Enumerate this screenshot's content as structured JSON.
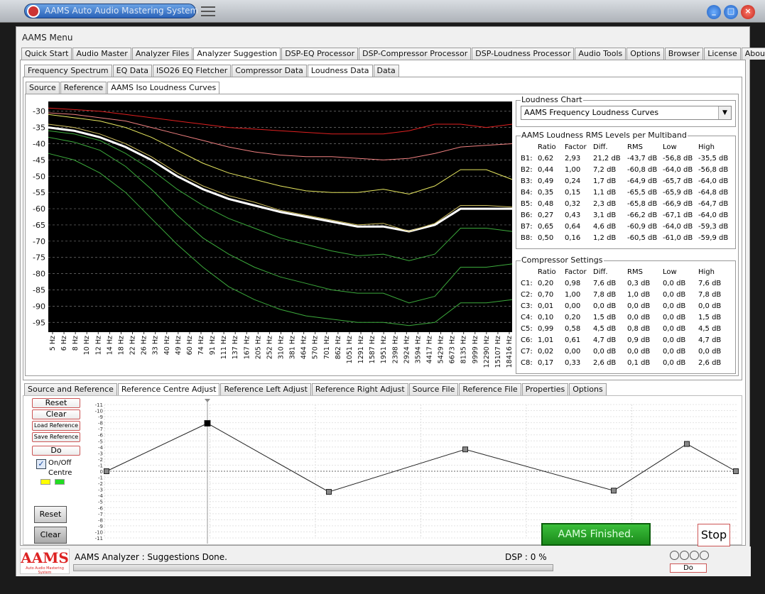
{
  "window": {
    "title": "AAMS Auto Audio Mastering System",
    "min": "_",
    "max": "□",
    "close": "×"
  },
  "menu_title": "AAMS Menu",
  "main_tabs": [
    "Quick Start",
    "Audio Master",
    "Analyzer Files",
    "Analyzer Suggestion",
    "DSP-EQ Processor",
    "DSP-Compressor Processor",
    "DSP-Loudness Processor",
    "Audio Tools",
    "Options",
    "Browser",
    "License",
    "About"
  ],
  "sub_tabs": [
    "Frequency Spectrum",
    "EQ Data",
    "ISO26 EQ Fletcher",
    "Compressor Data",
    "Loudness Data",
    "Data"
  ],
  "sub_sub_tabs": [
    "Source",
    "Reference",
    "AAMS Iso Loudness Curves"
  ],
  "chart_data": {
    "type": "line",
    "y_ticks": [
      "-30",
      "-35",
      "-40",
      "-45",
      "-50",
      "-55",
      "-60",
      "-65",
      "-70",
      "-75",
      "-80",
      "-85",
      "-90",
      "-95"
    ],
    "ylim": [
      -98,
      -27
    ],
    "x_ticks": [
      "5 Hz",
      "6 Hz",
      "8 Hz",
      "10 Hz",
      "12 Hz",
      "14 Hz",
      "18 Hz",
      "22 Hz",
      "26 Hz",
      "33 Hz",
      "40 Hz",
      "49 Hz",
      "60 Hz",
      "74 Hz",
      "91 Hz",
      "111 Hz",
      "137 Hz",
      "167 Hz",
      "205 Hz",
      "252 Hz",
      "310 Hz",
      "381 Hz",
      "464 Hz",
      "570 Hz",
      "701 Hz",
      "862 Hz",
      "1051 Hz",
      "1291 Hz",
      "1587 Hz",
      "1951 Hz",
      "2398 Hz",
      "2924 Hz",
      "3594 Hz",
      "4417 Hz",
      "5429 Hz",
      "6673 Hz",
      "8135 Hz",
      "9999 Hz",
      "12290 Hz",
      "15107 Hz",
      "18416 Hz"
    ],
    "grid": true,
    "series": [
      {
        "color": "#e02020",
        "values": [
          -29,
          -29.5,
          -30,
          -31,
          -32,
          -33,
          -34,
          -35,
          -35.5,
          -36,
          -36.5,
          -37,
          -37,
          -37,
          -36,
          -34,
          -34,
          -35,
          -34
        ]
      },
      {
        "color": "#f08080",
        "values": [
          -30.5,
          -31,
          -32,
          -33,
          -35,
          -37,
          -39,
          -41,
          -42.5,
          -43.5,
          -44,
          -44,
          -44.5,
          -45,
          -44.5,
          -43,
          -41,
          -40.5,
          -40
        ]
      },
      {
        "color": "#e8e860",
        "values": [
          -31,
          -32,
          -33,
          -35,
          -38,
          -42,
          -46,
          -49,
          -51,
          -53,
          -54.5,
          -55,
          -55,
          -54,
          -55.5,
          -53,
          -48,
          -48,
          -51
        ]
      },
      {
        "color": "#ffffff",
        "values": [
          -35,
          -36,
          -38,
          -41,
          -45,
          -50,
          -54,
          -57,
          -59,
          -61,
          -62.5,
          -64,
          -65.5,
          -65.5,
          -67,
          -65,
          -60,
          -60,
          -60
        ]
      },
      {
        "color": "#d0c060",
        "values": [
          -34,
          -35,
          -37,
          -40,
          -44,
          -49,
          -53,
          -56,
          -58,
          -60.5,
          -62,
          -63.5,
          -65,
          -64.5,
          -67,
          -64.5,
          -59,
          -59,
          -59.5
        ]
      },
      {
        "color": "#3caa3c",
        "values": [
          -36,
          -37,
          -39,
          -43,
          -48,
          -54,
          -59,
          -63,
          -66,
          -69,
          -71,
          -73,
          -74.5,
          -74,
          -76,
          -74,
          -66,
          -66,
          -67
        ]
      },
      {
        "color": "#3caa3c",
        "values": [
          -38,
          -39.5,
          -42,
          -47,
          -54,
          -62,
          -69,
          -74,
          -78,
          -81,
          -83,
          -85,
          -86,
          -86,
          -89,
          -87,
          -78,
          -78,
          -77
        ]
      },
      {
        "color": "#3caa3c",
        "values": [
          -43,
          -45,
          -49,
          -55,
          -63,
          -71,
          -78,
          -84,
          -88,
          -91,
          -93,
          -94,
          -95,
          -95,
          -96,
          -95,
          -89,
          -89,
          -88
        ]
      }
    ]
  },
  "loudness_chart": {
    "label": "Loudness Chart",
    "selected": "AAMS Frequency Loudness Curves"
  },
  "rms_table": {
    "label": "AAMS Loudness RMS Levels per Multiband",
    "headers": [
      "",
      "Ratio",
      "Factor",
      "Diff.",
      "RMS",
      "Low",
      "High"
    ],
    "rows": [
      [
        "B1:",
        "0,62",
        "2,93",
        "21,2 dB",
        "-43,7 dB",
        "-56,8 dB",
        "-35,5 dB"
      ],
      [
        "B2:",
        "0,44",
        "1,00",
        "7,2 dB",
        "-60,8 dB",
        "-64,0 dB",
        "-56,8 dB"
      ],
      [
        "B3:",
        "0,49",
        "0,24",
        "1,7 dB",
        "-64,9 dB",
        "-65,7 dB",
        "-64,0 dB"
      ],
      [
        "B4:",
        "0,35",
        "0,15",
        "1,1 dB",
        "-65,5 dB",
        "-65,9 dB",
        "-64,8 dB"
      ],
      [
        "B5:",
        "0,48",
        "0,32",
        "2,3 dB",
        "-65,8 dB",
        "-66,9 dB",
        "-64,7 dB"
      ],
      [
        "B6:",
        "0,27",
        "0,43",
        "3,1 dB",
        "-66,2 dB",
        "-67,1 dB",
        "-64,0 dB"
      ],
      [
        "B7:",
        "0,65",
        "0,64",
        "4,6 dB",
        "-60,9 dB",
        "-64,0 dB",
        "-59,3 dB"
      ],
      [
        "B8:",
        "0,50",
        "0,16",
        "1,2 dB",
        "-60,5 dB",
        "-61,0 dB",
        "-59,9 dB"
      ]
    ]
  },
  "comp_table": {
    "label": "Compressor Settings",
    "headers": [
      "",
      "Ratio",
      "Factor",
      "Diff.",
      "RMS",
      "Low",
      "High"
    ],
    "rows": [
      [
        "C1:",
        "0,20",
        "0,98",
        "7,6 dB",
        "0,3 dB",
        "0,0 dB",
        "7,6 dB"
      ],
      [
        "C2:",
        "0,70",
        "1,00",
        "7,8 dB",
        "1,0 dB",
        "0,0 dB",
        "7,8 dB"
      ],
      [
        "C3:",
        "0,01",
        "0,00",
        "0,0 dB",
        "0,0 dB",
        "0,0 dB",
        "0,0 dB"
      ],
      [
        "C4:",
        "0,10",
        "0,20",
        "1,5 dB",
        "0,0 dB",
        "0,0 dB",
        "1,5 dB"
      ],
      [
        "C5:",
        "0,99",
        "0,58",
        "4,5 dB",
        "0,8 dB",
        "0,0 dB",
        "4,5 dB"
      ],
      [
        "C6:",
        "1,01",
        "0,61",
        "4,7 dB",
        "0,9 dB",
        "0,0 dB",
        "4,7 dB"
      ],
      [
        "C7:",
        "0,02",
        "0,00",
        "0,0 dB",
        "0,0 dB",
        "0,0 dB",
        "0,0 dB"
      ],
      [
        "C8:",
        "0,17",
        "0,33",
        "2,6 dB",
        "0,1 dB",
        "0,0 dB",
        "2,6 dB"
      ]
    ]
  },
  "lower_tabs": [
    "Source and Reference",
    "Reference Centre Adjust",
    "Reference Left Adjust",
    "Reference Right Adjust",
    "Source File",
    "Reference File",
    "Properties",
    "Options"
  ],
  "side_buttons": {
    "reset": "Reset",
    "clear": "Clear",
    "load": "Load Reference",
    "save": "Save Reference",
    "do": "Do",
    "onoff": "On/Off",
    "centre": "Centre",
    "reset2": "Reset",
    "clear2": "Clear"
  },
  "adjust_chart": {
    "y_ticks": [
      "-11",
      "-10",
      "-9",
      "-8",
      "-7",
      "-6",
      "-5",
      "-4",
      "-3",
      "-2",
      "-1",
      "0",
      "-1",
      "-2",
      "-3",
      "-4",
      "-5",
      "-6",
      "-7",
      "-8",
      "-9",
      "-10",
      "-11"
    ],
    "points": [
      0,
      7.9,
      -3.4,
      3.6,
      -3.2,
      4.5,
      0
    ]
  },
  "status": {
    "analyzer": "AAMS Analyzer : Suggestions Done.",
    "dsp": "DSP :   0 %",
    "finished": "AAMS Finished.",
    "do": "Do",
    "stop": "Stop",
    "logo": "AAMS",
    "logo_sub": "Auto Audio Mastering System"
  },
  "colors": {
    "accent": "#2a62b8",
    "finished": "#2aa02a"
  }
}
